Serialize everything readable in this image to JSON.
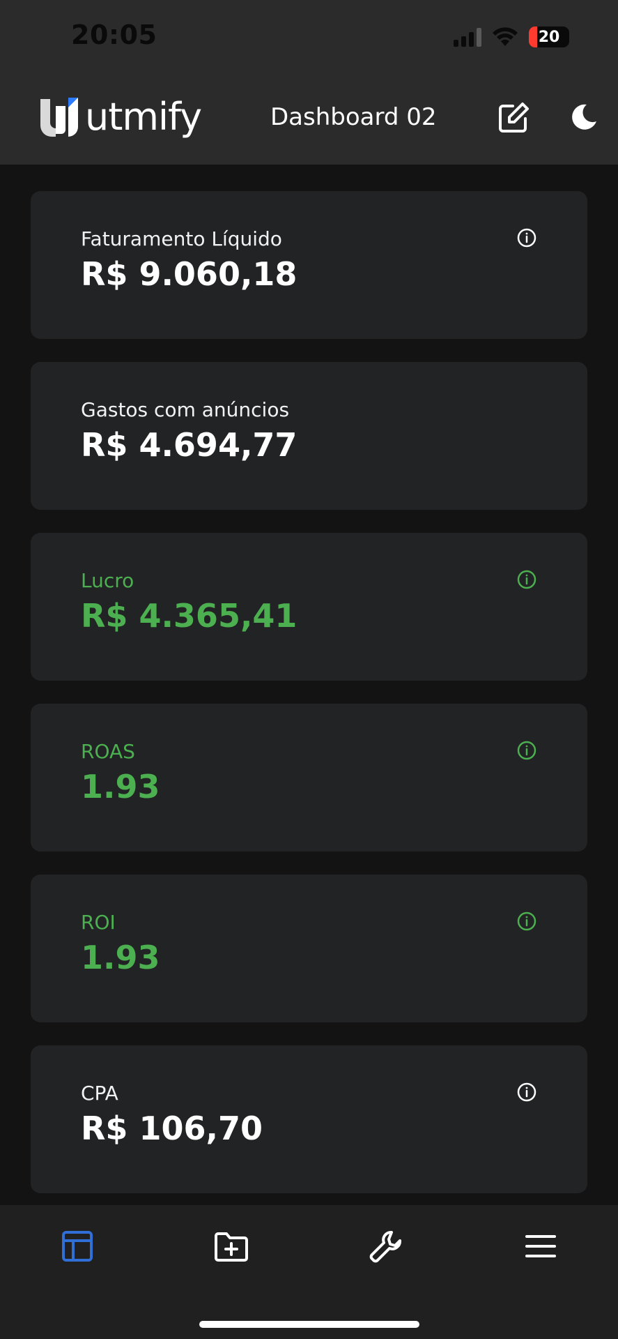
{
  "status_bar": {
    "time": "20:05",
    "battery": "20"
  },
  "header": {
    "logo_text": "utmify",
    "title": "Dashboard 02",
    "icons": [
      "edit-icon",
      "moon-icon"
    ]
  },
  "cards": [
    {
      "label": "Faturamento Líquido",
      "value": "R$ 9.060,18",
      "has_info": true,
      "color": "#ffffff"
    },
    {
      "label": "Gastos com anúncios",
      "value": "R$ 4.694,77",
      "has_info": false,
      "color": "#ffffff"
    },
    {
      "label": "Lucro",
      "value": "R$ 4.365,41",
      "has_info": true,
      "color": "#4caf50"
    },
    {
      "label": "ROAS",
      "value": "1.93",
      "has_info": true,
      "color": "#4caf50"
    },
    {
      "label": "ROI",
      "value": "1.93",
      "has_info": true,
      "color": "#4caf50"
    },
    {
      "label": "CPA",
      "value": "R$ 106,70",
      "has_info": true,
      "color": "#ffffff"
    }
  ],
  "bottom_nav": {
    "items": [
      "dashboard-icon",
      "folder-add-icon",
      "wrench-icon",
      "menu-icon"
    ],
    "active_color": "#2f6fd6"
  }
}
